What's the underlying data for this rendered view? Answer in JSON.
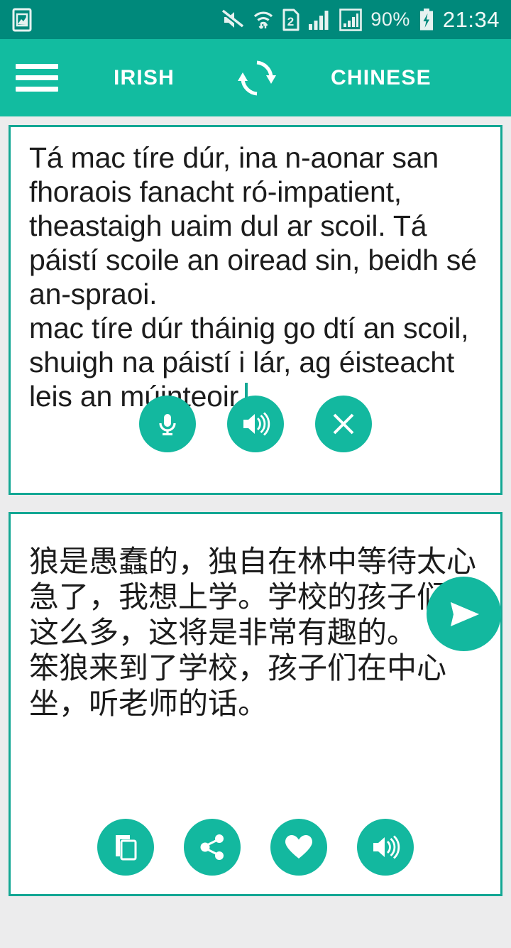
{
  "status_bar": {
    "notification_icon": "image-icon",
    "mute_icon": "mute-icon",
    "wifi_icon": "wifi-transfer-icon",
    "sim_label": "2",
    "signal_icon": "signal-bars-icon",
    "signal2_icon": "signal-bars-boxed-icon",
    "battery_percent": "90%",
    "battery_icon": "battery-charging-icon",
    "time": "21:34",
    "bg_color": "#00897b"
  },
  "header": {
    "menu_icon": "hamburger-menu-icon",
    "source_language": "IRISH",
    "swap_icon": "swap-languages-icon",
    "target_language": "CHINESE",
    "bg_color": "#12bca0"
  },
  "source_panel": {
    "text": "Tá mac tíre dúr, ina n-aonar san fhoraois fanacht ró-impatient, theastaigh uaim dul ar scoil. Tá páistí scoile an oiread sin, beidh sé an-spraoi.\nmac tíre dúr tháinig go dtí an scoil, shuigh na páistí i lár, ag éisteacht leis an múinteoir.",
    "buttons": [
      {
        "name": "microphone-button",
        "icon": "microphone-icon"
      },
      {
        "name": "speak-source-button",
        "icon": "speaker-icon"
      },
      {
        "name": "clear-text-button",
        "icon": "close-icon"
      }
    ]
  },
  "send_button": {
    "name": "translate-send-button",
    "icon": "send-paper-plane-icon",
    "color": "#13b89f"
  },
  "target_panel": {
    "text": "狼是愚蠢的，独自在林中等待太心急了，我想上学。学校的孩子们有这么多，这将是非常有趣的。\n笨狼来到了学校，孩子们在中心坐，听老师的话。",
    "buttons": [
      {
        "name": "copy-button",
        "icon": "copy-icon"
      },
      {
        "name": "share-button",
        "icon": "share-icon"
      },
      {
        "name": "favorite-button",
        "icon": "heart-icon"
      },
      {
        "name": "speak-translation-button",
        "icon": "speaker-icon"
      }
    ]
  },
  "theme": {
    "accent": "#13b89f",
    "panel_border": "#13a794",
    "page_bg": "#ececed"
  }
}
